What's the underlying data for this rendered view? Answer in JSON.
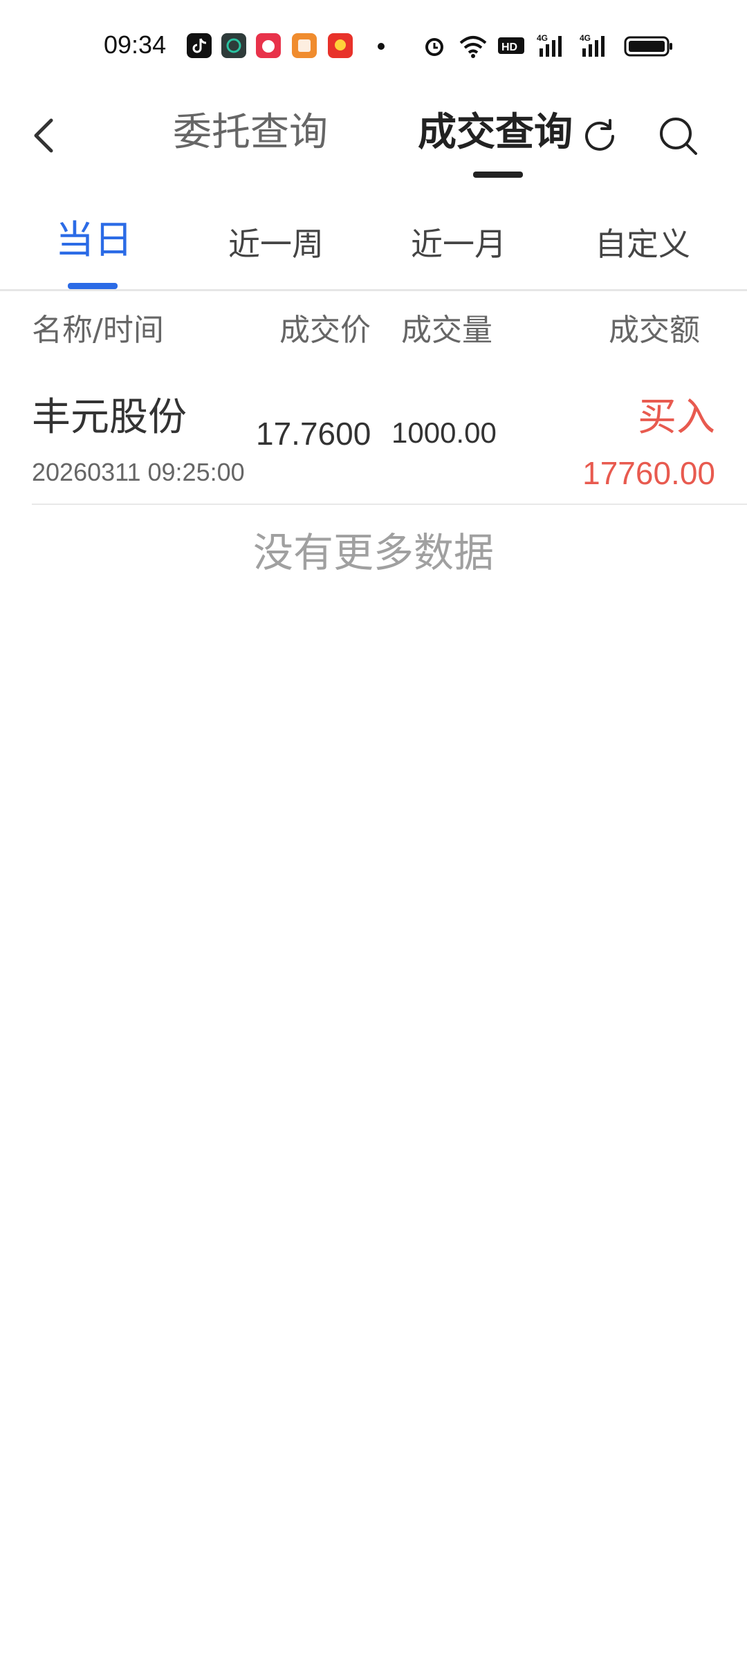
{
  "status_bar": {
    "time": "09:34",
    "icons": [
      "douyin-app-icon",
      "chatgpt-app-icon",
      "pinduoduo-app-icon",
      "books-app-icon",
      "toutiao-app-icon",
      "dot-icon",
      "alarm-icon",
      "wifi-icon",
      "hd-icon",
      "signal-4g-icon",
      "signal-4g-icon",
      "battery-icon"
    ]
  },
  "header": {
    "back_icon": "back-arrow-icon",
    "tabs": [
      {
        "label": "委托查询"
      },
      {
        "label": "成交查询"
      }
    ],
    "refresh_icon": "refresh-icon",
    "search_icon": "search-icon"
  },
  "date_tabs": [
    {
      "label": "当日"
    },
    {
      "label": "近一周"
    },
    {
      "label": "近一月"
    },
    {
      "label": "自定义"
    }
  ],
  "columns": {
    "name_time": "名称/时间",
    "price": "成交价",
    "volume": "成交量",
    "amount": "成交额"
  },
  "trades": [
    {
      "name": "丰元股份",
      "time": "20260311 09:25:00",
      "price": "17.7600",
      "volume": "1000.00",
      "direction": "买入",
      "amount": "17760.00"
    }
  ],
  "no_more": "没有更多数据",
  "colors": {
    "accent_blue": "#2b6be6",
    "buy_red": "#e85a4f"
  }
}
